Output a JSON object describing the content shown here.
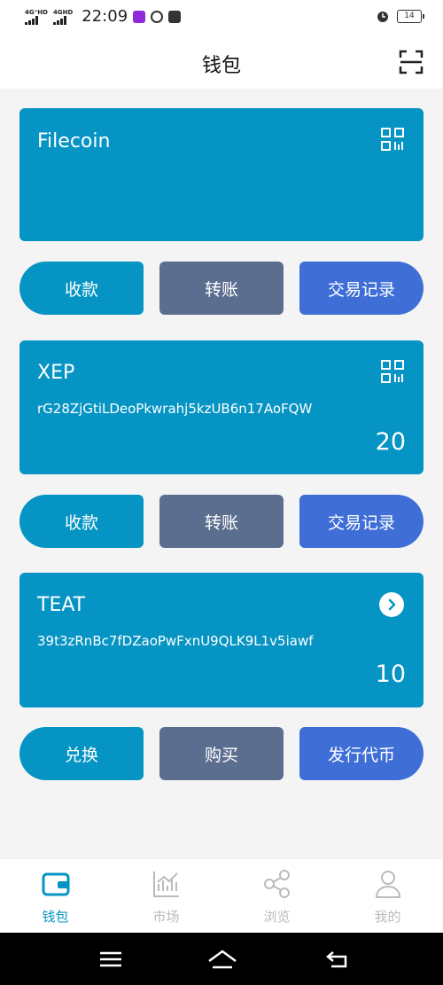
{
  "status_bar": {
    "signal1": "4G⁺HD",
    "signal2": "4GHD",
    "time": "22:09",
    "battery": "14"
  },
  "header": {
    "title": "钱包"
  },
  "wallets": [
    {
      "name": "Filecoin",
      "address": "",
      "balance": "",
      "action_icon": "qr-code-icon"
    },
    {
      "name": "XEP",
      "address": "rG28ZjGtiLDeoPkwrahj5kzUB6n17AoFQW",
      "balance": "20",
      "action_icon": "qr-code-icon"
    },
    {
      "name": "TEAT",
      "address": "39t3zRnBc7fDZaoPwFxnU9QLK9L1v5iawf",
      "balance": "10",
      "action_icon": "chevron-right-icon"
    }
  ],
  "actions": [
    {
      "receive": "收款",
      "transfer": "转账",
      "history": "交易记录"
    },
    {
      "receive": "收款",
      "transfer": "转账",
      "history": "交易记录"
    },
    {
      "exchange": "兑换",
      "buy": "购买",
      "issue": "发行代币"
    }
  ],
  "tabs": [
    {
      "label": "钱包",
      "icon": "wallet-icon",
      "active": true
    },
    {
      "label": "市场",
      "icon": "chart-icon",
      "active": false
    },
    {
      "label": "浏览",
      "icon": "share-icon",
      "active": false
    },
    {
      "label": "我的",
      "icon": "user-icon",
      "active": false
    }
  ],
  "colors": {
    "card": "#0594c3",
    "button_gray": "#5c6e90",
    "button_blue": "#3f6fd6",
    "tab_active": "#0594c3",
    "tab_inactive": "#bbbbbb"
  }
}
